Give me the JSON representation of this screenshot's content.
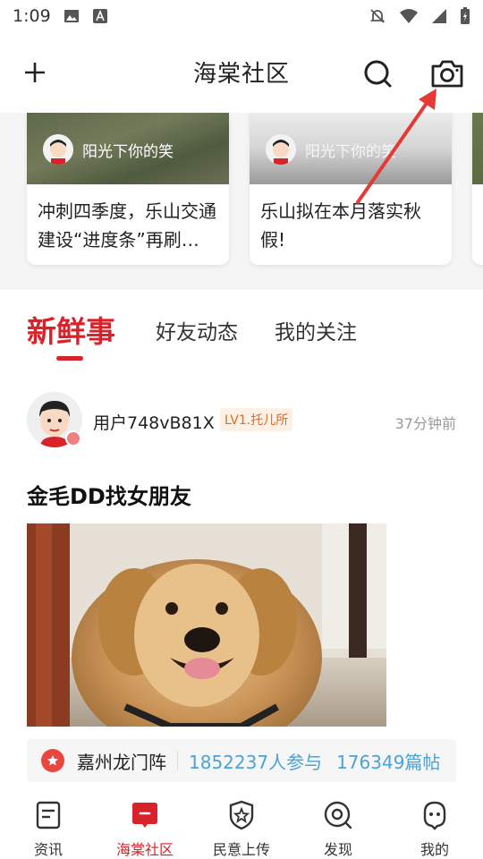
{
  "status_bar": {
    "time": "1:09"
  },
  "app_bar": {
    "title": "海棠社区"
  },
  "carousel": {
    "cards": [
      {
        "author": "阳光下你的笑",
        "text": "冲刺四季度，乐山交通建设“进度条”再刷…"
      },
      {
        "author": "阳光下你的笑",
        "text": "乐山拟在本月落实秋假!"
      }
    ]
  },
  "tabs": [
    {
      "label": "新鲜事"
    },
    {
      "label": "好友动态"
    },
    {
      "label": "我的关注"
    }
  ],
  "post": {
    "username": "用户748vB81X",
    "level": "LV1.托儿所",
    "time": "37分钟前",
    "title": "金毛DD找女朋友"
  },
  "topic": {
    "name": "嘉州龙门阵",
    "participants": "1852237人参与",
    "posts": "176349篇帖"
  },
  "bottom_nav": [
    {
      "label": "资讯",
      "icon": "news-icon"
    },
    {
      "label": "海棠社区",
      "icon": "community-icon"
    },
    {
      "label": "民意上传",
      "icon": "badge-upload-icon"
    },
    {
      "label": "发现",
      "icon": "discover-icon"
    },
    {
      "label": "我的",
      "icon": "profile-icon"
    }
  ],
  "colors": {
    "accent": "#d8232a",
    "link": "#4aa3d8",
    "level": "#e06a2a"
  }
}
